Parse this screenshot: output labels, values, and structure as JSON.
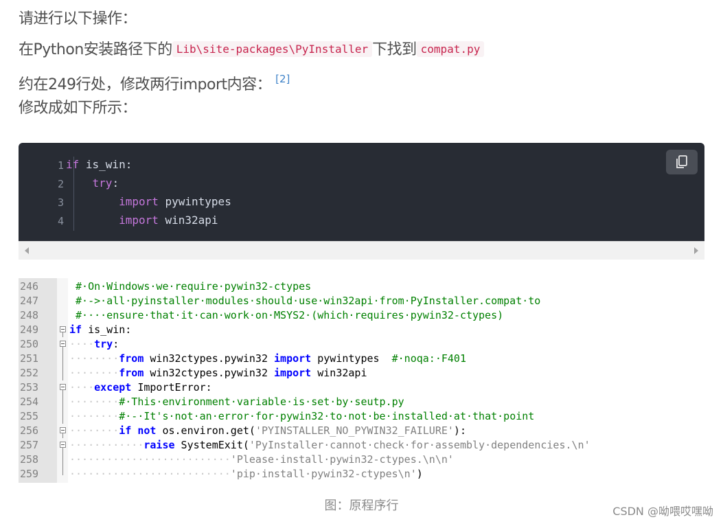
{
  "paragraphs": {
    "p1": "请进行以下操作：",
    "p2_before": "在Python安装路径下的",
    "p2_code1": "Lib\\site-packages\\PyInstaller",
    "p2_mid": "下找到",
    "p2_code2": "compat.py",
    "p3": "约在249行处，修改两行import内容：",
    "p3_ref": "[2]",
    "p4": "修改成如下所示："
  },
  "code_block": {
    "line_numbers": [
      "1",
      "2",
      "3",
      "4"
    ],
    "lines": [
      {
        "indent": "",
        "kw": "if",
        "rest": " is_win:"
      },
      {
        "indent": "    ",
        "kw": "try",
        "rest": ":"
      },
      {
        "indent": "        ",
        "kw": "import",
        "rest": " pywintypes"
      },
      {
        "indent": "        ",
        "kw": "import",
        "rest": " win32api"
      }
    ],
    "copy_icon": "copy-icon"
  },
  "screenshot": {
    "rows": [
      {
        "num": "246",
        "fold": "none",
        "segments": [
          {
            "c": "cm",
            "t": " #·On·Windows·we·require·pywin32-ctypes"
          }
        ]
      },
      {
        "num": "247",
        "fold": "none",
        "segments": [
          {
            "c": "cm",
            "t": " #·->·all·pyinstaller·modules·should·use·win32api·from·PyInstaller.compat·to"
          }
        ]
      },
      {
        "num": "248",
        "fold": "none",
        "segments": [
          {
            "c": "cm",
            "t": " #····ensure·that·it·can·work·on·MSYS2·(which·requires·pywin32-ctypes)"
          }
        ]
      },
      {
        "num": "249",
        "fold": "box",
        "segments": [
          {
            "c": "skw",
            "t": "if"
          },
          {
            "c": "",
            "t": " is_win:"
          }
        ]
      },
      {
        "num": "250",
        "fold": "box",
        "segments": [
          {
            "c": "dots",
            "t": "····"
          },
          {
            "c": "skw",
            "t": "try"
          },
          {
            "c": "",
            "t": ":"
          }
        ]
      },
      {
        "num": "251",
        "fold": "line",
        "segments": [
          {
            "c": "dots",
            "t": "········"
          },
          {
            "c": "skw",
            "t": "from"
          },
          {
            "c": "",
            "t": " win32ctypes.pywin32 "
          },
          {
            "c": "skw",
            "t": "import"
          },
          {
            "c": "",
            "t": " pywintypes  "
          },
          {
            "c": "cm",
            "t": "#·noqa:·F401"
          }
        ]
      },
      {
        "num": "252",
        "fold": "line",
        "segments": [
          {
            "c": "dots",
            "t": "········"
          },
          {
            "c": "skw",
            "t": "from"
          },
          {
            "c": "",
            "t": " win32ctypes.pywin32 "
          },
          {
            "c": "skw",
            "t": "import"
          },
          {
            "c": "",
            "t": " win32api"
          }
        ]
      },
      {
        "num": "253",
        "fold": "box",
        "segments": [
          {
            "c": "dots",
            "t": "····"
          },
          {
            "c": "skw",
            "t": "except"
          },
          {
            "c": "",
            "t": " ImportError:"
          }
        ]
      },
      {
        "num": "254",
        "fold": "line",
        "segments": [
          {
            "c": "dots",
            "t": "········"
          },
          {
            "c": "cm",
            "t": "#·This·environment·variable·is·set·by·seutp.py"
          }
        ]
      },
      {
        "num": "255",
        "fold": "line",
        "segments": [
          {
            "c": "dots",
            "t": "········"
          },
          {
            "c": "cm",
            "t": "#·-·It's·not·an·error·for·pywin32·to·not·be·installed·at·that·point"
          }
        ]
      },
      {
        "num": "256",
        "fold": "box",
        "segments": [
          {
            "c": "dots",
            "t": "········"
          },
          {
            "c": "skw",
            "t": "if"
          },
          {
            "c": "",
            "t": " "
          },
          {
            "c": "skw",
            "t": "not"
          },
          {
            "c": "",
            "t": " os.environ.get("
          },
          {
            "c": "str",
            "t": "'PYINSTALLER_NO_PYWIN32_FAILURE'"
          },
          {
            "c": "",
            "t": "):"
          }
        ]
      },
      {
        "num": "257",
        "fold": "box",
        "segments": [
          {
            "c": "dots",
            "t": "············"
          },
          {
            "c": "skw",
            "t": "raise"
          },
          {
            "c": "",
            "t": " SystemExit("
          },
          {
            "c": "str",
            "t": "'PyInstaller·cannot·check·for·assembly·dependencies.\\n'"
          }
        ]
      },
      {
        "num": "258",
        "fold": "line",
        "segments": [
          {
            "c": "dots",
            "t": "··························"
          },
          {
            "c": "str",
            "t": "'Please·install·pywin32-ctypes.\\n\\n'"
          }
        ]
      },
      {
        "num": "259",
        "fold": "end",
        "segments": [
          {
            "c": "dots",
            "t": "··························"
          },
          {
            "c": "str",
            "t": "'pip·install·pywin32-ctypes\\n'"
          },
          {
            "c": "",
            "t": ")"
          }
        ]
      }
    ]
  },
  "caption": "图：原程序行",
  "watermark": "CSDN @呦喂哎嘿呦"
}
